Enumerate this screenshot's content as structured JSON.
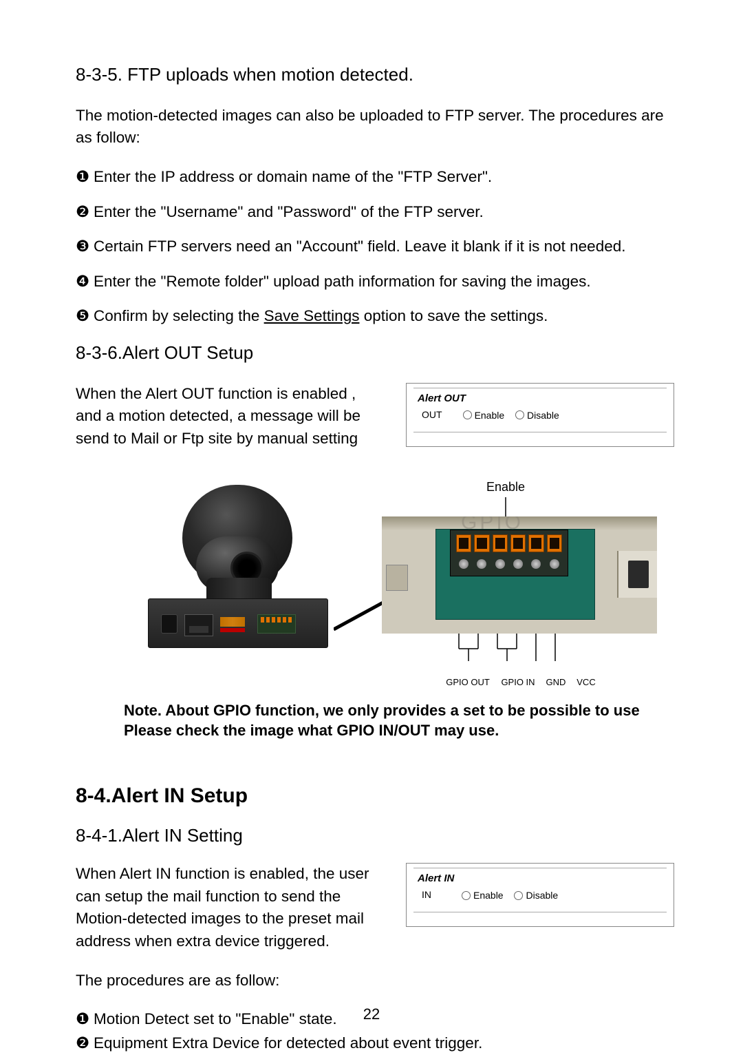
{
  "sections": {
    "s835": {
      "heading": "8-3-5. FTP uploads when motion detected.",
      "intro": "The motion-detected images can also be uploaded to FTP server. The procedures are as follow:",
      "steps": [
        {
          "bullet": "❶",
          "text_a": "Enter the IP address or domain name of the \"FTP Server\"."
        },
        {
          "bullet": "❷",
          "text_a": "Enter the \"Username\" and \"Password\" of the FTP server."
        },
        {
          "bullet": "❸",
          "text_a": "Certain FTP servers need an \"Account\" field. Leave it blank if it is not needed."
        },
        {
          "bullet": "❹",
          "text_a": "Enter the \"Remote folder\" upload path information for saving the images."
        },
        {
          "bullet": "❺",
          "text_a": "Confirm by selecting the ",
          "link": "Save Settings",
          "text_b": " option to save the settings."
        }
      ]
    },
    "s836": {
      "heading": "8-3-6.Alert OUT Setup",
      "para": "When the Alert OUT function is enabled , and a motion detected, a message will be send to Mail or Ftp site by manual setting",
      "box": {
        "title": "Alert OUT",
        "label": "OUT",
        "opt_enable": "Enable",
        "opt_disable": "Disable"
      },
      "figure": {
        "enable_label": "Enable",
        "gpio_faint": "GPIO",
        "label_out": "GPIO OUT",
        "label_in": "GPIO IN",
        "label_gnd": "GND",
        "label_vcc": "VCC"
      },
      "note_line1": "Note. About GPIO function, we only provides a set to be possible to use",
      "note_line2": "Please check the image what GPIO IN/OUT may use."
    },
    "s84": {
      "heading": "8-4.Alert IN Setup",
      "sub_heading": "8-4-1.Alert IN Setting",
      "para": "When Alert IN function is enabled, the user can setup the mail function to send the Motion-detected images to the preset mail address when extra device triggered.",
      "box": {
        "title": "Alert IN",
        "label": "IN",
        "opt_enable": "Enable",
        "opt_disable": "Disable"
      },
      "proc_intro": "The procedures are as follow:",
      "steps": [
        {
          "bullet": "❶",
          "text": "Motion Detect set to \"Enable\" state."
        },
        {
          "bullet": "❷",
          "text": "Equipment Extra Device for detected about event trigger."
        }
      ]
    }
  },
  "page_number": "22"
}
